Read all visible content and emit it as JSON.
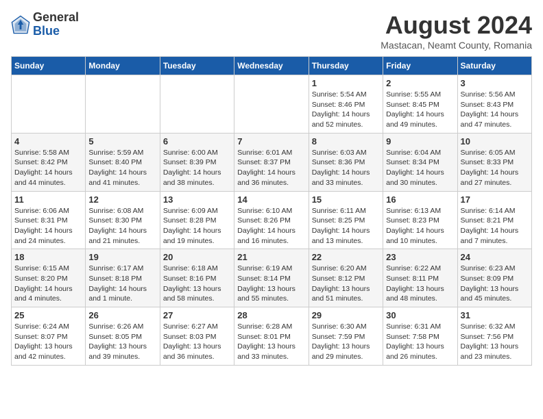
{
  "logo": {
    "general": "General",
    "blue": "Blue"
  },
  "title": {
    "month_year": "August 2024",
    "location": "Mastacan, Neamt County, Romania"
  },
  "days_of_week": [
    "Sunday",
    "Monday",
    "Tuesday",
    "Wednesday",
    "Thursday",
    "Friday",
    "Saturday"
  ],
  "weeks": [
    [
      {
        "day": "",
        "info": ""
      },
      {
        "day": "",
        "info": ""
      },
      {
        "day": "",
        "info": ""
      },
      {
        "day": "",
        "info": ""
      },
      {
        "day": "1",
        "info": "Sunrise: 5:54 AM\nSunset: 8:46 PM\nDaylight: 14 hours\nand 52 minutes."
      },
      {
        "day": "2",
        "info": "Sunrise: 5:55 AM\nSunset: 8:45 PM\nDaylight: 14 hours\nand 49 minutes."
      },
      {
        "day": "3",
        "info": "Sunrise: 5:56 AM\nSunset: 8:43 PM\nDaylight: 14 hours\nand 47 minutes."
      }
    ],
    [
      {
        "day": "4",
        "info": "Sunrise: 5:58 AM\nSunset: 8:42 PM\nDaylight: 14 hours\nand 44 minutes."
      },
      {
        "day": "5",
        "info": "Sunrise: 5:59 AM\nSunset: 8:40 PM\nDaylight: 14 hours\nand 41 minutes."
      },
      {
        "day": "6",
        "info": "Sunrise: 6:00 AM\nSunset: 8:39 PM\nDaylight: 14 hours\nand 38 minutes."
      },
      {
        "day": "7",
        "info": "Sunrise: 6:01 AM\nSunset: 8:37 PM\nDaylight: 14 hours\nand 36 minutes."
      },
      {
        "day": "8",
        "info": "Sunrise: 6:03 AM\nSunset: 8:36 PM\nDaylight: 14 hours\nand 33 minutes."
      },
      {
        "day": "9",
        "info": "Sunrise: 6:04 AM\nSunset: 8:34 PM\nDaylight: 14 hours\nand 30 minutes."
      },
      {
        "day": "10",
        "info": "Sunrise: 6:05 AM\nSunset: 8:33 PM\nDaylight: 14 hours\nand 27 minutes."
      }
    ],
    [
      {
        "day": "11",
        "info": "Sunrise: 6:06 AM\nSunset: 8:31 PM\nDaylight: 14 hours\nand 24 minutes."
      },
      {
        "day": "12",
        "info": "Sunrise: 6:08 AM\nSunset: 8:30 PM\nDaylight: 14 hours\nand 21 minutes."
      },
      {
        "day": "13",
        "info": "Sunrise: 6:09 AM\nSunset: 8:28 PM\nDaylight: 14 hours\nand 19 minutes."
      },
      {
        "day": "14",
        "info": "Sunrise: 6:10 AM\nSunset: 8:26 PM\nDaylight: 14 hours\nand 16 minutes."
      },
      {
        "day": "15",
        "info": "Sunrise: 6:11 AM\nSunset: 8:25 PM\nDaylight: 14 hours\nand 13 minutes."
      },
      {
        "day": "16",
        "info": "Sunrise: 6:13 AM\nSunset: 8:23 PM\nDaylight: 14 hours\nand 10 minutes."
      },
      {
        "day": "17",
        "info": "Sunrise: 6:14 AM\nSunset: 8:21 PM\nDaylight: 14 hours\nand 7 minutes."
      }
    ],
    [
      {
        "day": "18",
        "info": "Sunrise: 6:15 AM\nSunset: 8:20 PM\nDaylight: 14 hours\nand 4 minutes."
      },
      {
        "day": "19",
        "info": "Sunrise: 6:17 AM\nSunset: 8:18 PM\nDaylight: 14 hours\nand 1 minute."
      },
      {
        "day": "20",
        "info": "Sunrise: 6:18 AM\nSunset: 8:16 PM\nDaylight: 13 hours\nand 58 minutes."
      },
      {
        "day": "21",
        "info": "Sunrise: 6:19 AM\nSunset: 8:14 PM\nDaylight: 13 hours\nand 55 minutes."
      },
      {
        "day": "22",
        "info": "Sunrise: 6:20 AM\nSunset: 8:12 PM\nDaylight: 13 hours\nand 51 minutes."
      },
      {
        "day": "23",
        "info": "Sunrise: 6:22 AM\nSunset: 8:11 PM\nDaylight: 13 hours\nand 48 minutes."
      },
      {
        "day": "24",
        "info": "Sunrise: 6:23 AM\nSunset: 8:09 PM\nDaylight: 13 hours\nand 45 minutes."
      }
    ],
    [
      {
        "day": "25",
        "info": "Sunrise: 6:24 AM\nSunset: 8:07 PM\nDaylight: 13 hours\nand 42 minutes."
      },
      {
        "day": "26",
        "info": "Sunrise: 6:26 AM\nSunset: 8:05 PM\nDaylight: 13 hours\nand 39 minutes."
      },
      {
        "day": "27",
        "info": "Sunrise: 6:27 AM\nSunset: 8:03 PM\nDaylight: 13 hours\nand 36 minutes."
      },
      {
        "day": "28",
        "info": "Sunrise: 6:28 AM\nSunset: 8:01 PM\nDaylight: 13 hours\nand 33 minutes."
      },
      {
        "day": "29",
        "info": "Sunrise: 6:30 AM\nSunset: 7:59 PM\nDaylight: 13 hours\nand 29 minutes."
      },
      {
        "day": "30",
        "info": "Sunrise: 6:31 AM\nSunset: 7:58 PM\nDaylight: 13 hours\nand 26 minutes."
      },
      {
        "day": "31",
        "info": "Sunrise: 6:32 AM\nSunset: 7:56 PM\nDaylight: 13 hours\nand 23 minutes."
      }
    ]
  ]
}
